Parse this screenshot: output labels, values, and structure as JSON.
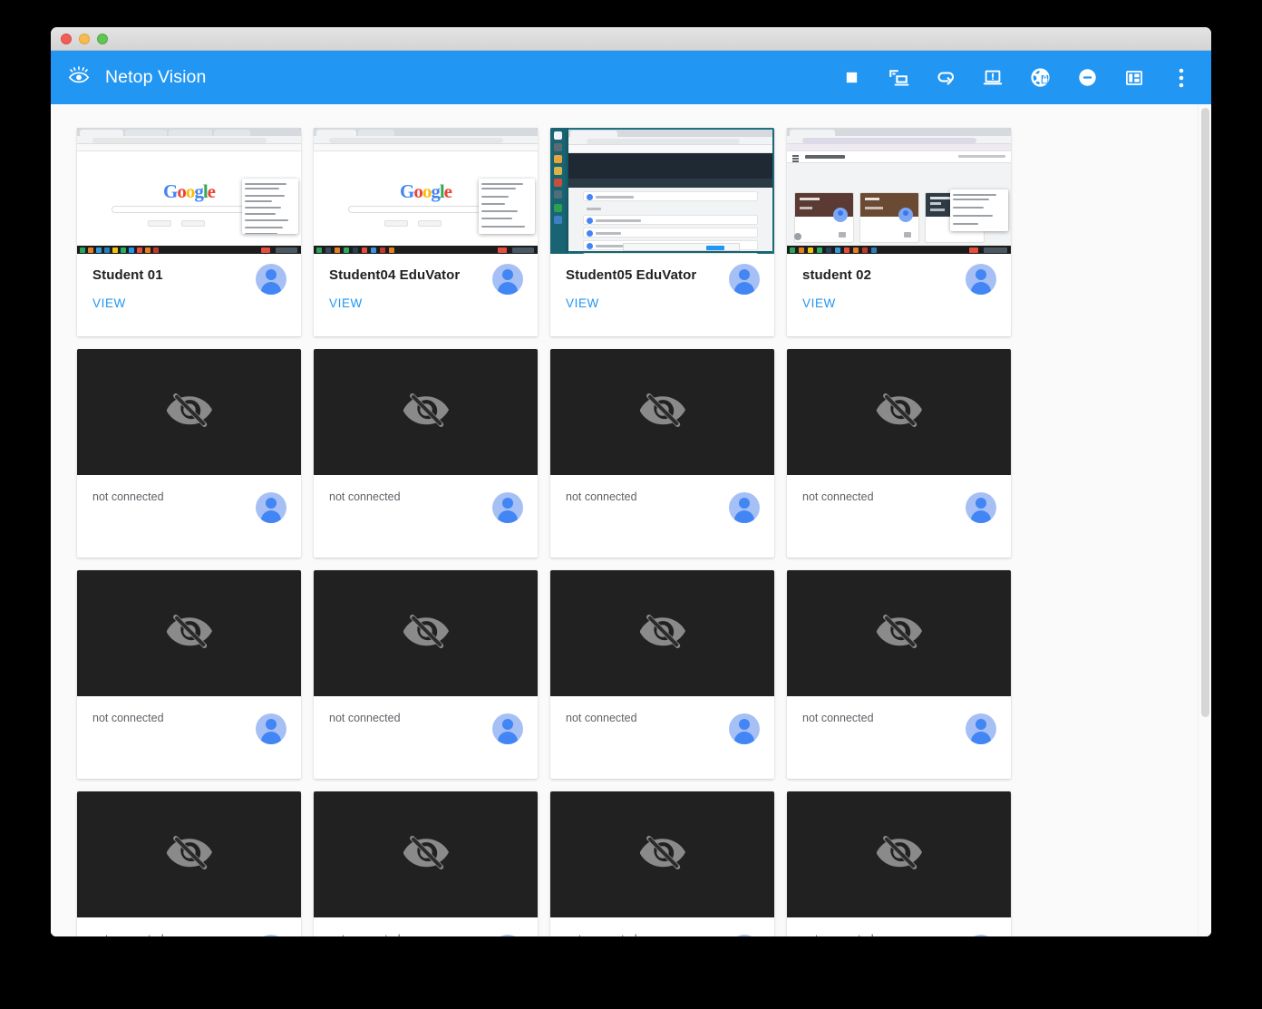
{
  "window": {
    "traffic_lights": [
      "close",
      "minimize",
      "maximize"
    ]
  },
  "header": {
    "app_title": "Netop Vision",
    "brand_icon": "eye-icon",
    "accent_color": "#2196f3",
    "toolbar": [
      {
        "name": "blank-screen-button",
        "icon": "stop-square-icon",
        "label": "Blank Screen"
      },
      {
        "name": "demo-button",
        "icon": "screen-share-icon",
        "label": "Demo"
      },
      {
        "name": "send-link-button",
        "icon": "link-forward-icon",
        "label": "Send Link"
      },
      {
        "name": "attention-button",
        "icon": "laptop-alert-icon",
        "label": "Attention"
      },
      {
        "name": "web-filter-button",
        "icon": "globe-lock-icon",
        "label": "Web Filtering"
      },
      {
        "name": "block-button",
        "icon": "minus-circle-icon",
        "label": "Block"
      },
      {
        "name": "layout-button",
        "icon": "panel-layout-icon",
        "label": "Layout"
      },
      {
        "name": "overflow-menu-button",
        "icon": "three-dots-icon",
        "label": "More options"
      }
    ]
  },
  "content": {
    "view_label": "VIEW",
    "not_connected_label": "not connected",
    "offline_icon": "eye-off-icon",
    "avatar_icon": "person-avatar-icon",
    "students": [
      {
        "name": "Student 01",
        "connected": true,
        "action": "VIEW",
        "screen": "google-search"
      },
      {
        "name": "Student04 EduVator",
        "connected": true,
        "action": "VIEW",
        "screen": "google-search"
      },
      {
        "name": "Student05 EduVator",
        "connected": true,
        "action": "VIEW",
        "screen": "windows-classroom"
      },
      {
        "name": "student 02",
        "connected": true,
        "action": "VIEW",
        "screen": "google-classroom"
      },
      {
        "name": "not connected",
        "connected": false
      },
      {
        "name": "not connected",
        "connected": false
      },
      {
        "name": "not connected",
        "connected": false
      },
      {
        "name": "not connected",
        "connected": false
      },
      {
        "name": "not connected",
        "connected": false
      },
      {
        "name": "not connected",
        "connected": false
      },
      {
        "name": "not connected",
        "connected": false
      },
      {
        "name": "not connected",
        "connected": false
      },
      {
        "name": "not connected",
        "connected": false
      },
      {
        "name": "not connected",
        "connected": false
      },
      {
        "name": "not connected",
        "connected": false
      },
      {
        "name": "not connected",
        "connected": false
      }
    ]
  },
  "scrollbar": {
    "name": "vertical-scrollbar"
  }
}
